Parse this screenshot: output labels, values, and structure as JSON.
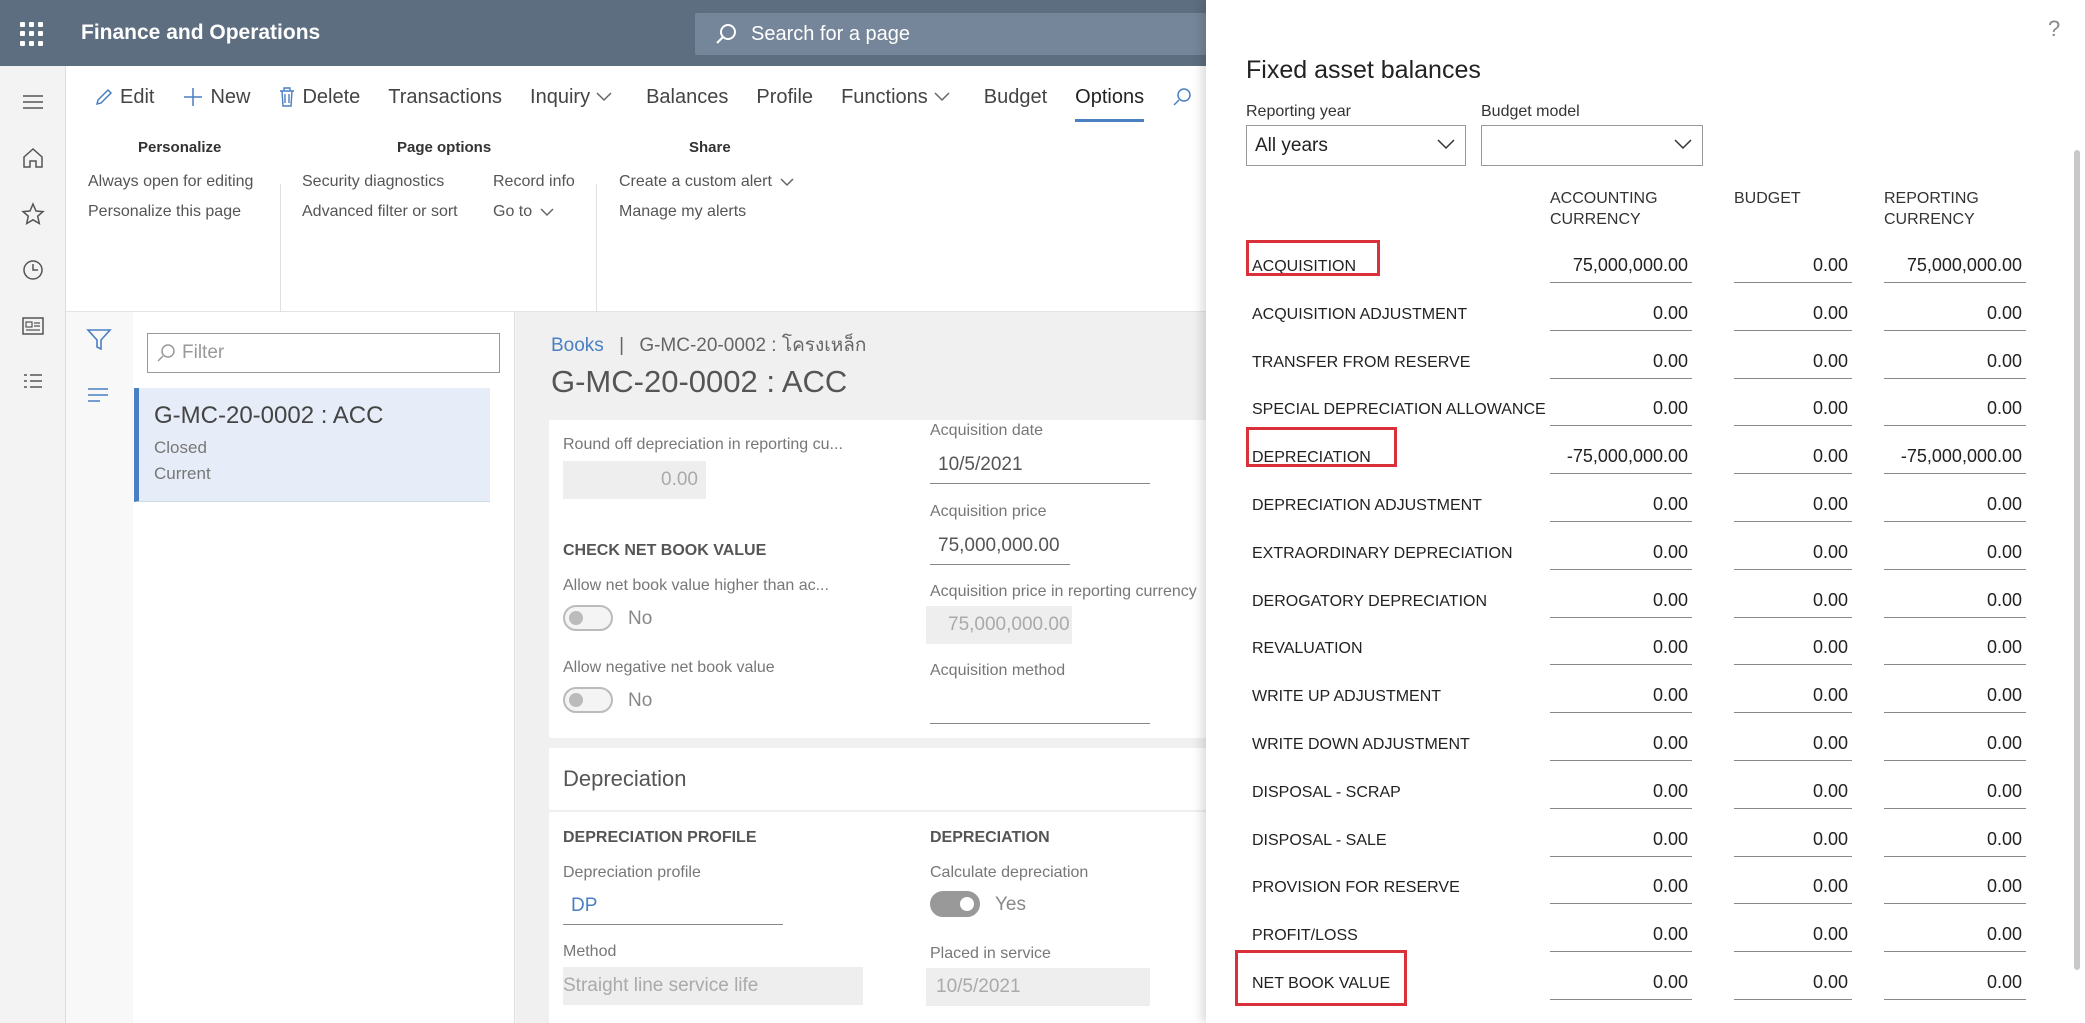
{
  "app": {
    "title": "Finance and Operations",
    "search_placeholder": "Search for a page"
  },
  "actions": [
    {
      "label": "Edit"
    },
    {
      "label": "New"
    },
    {
      "label": "Delete"
    },
    {
      "label": "Transactions"
    },
    {
      "label": "Inquiry"
    },
    {
      "label": "Balances"
    },
    {
      "label": "Profile"
    },
    {
      "label": "Functions"
    },
    {
      "label": "Budget"
    },
    {
      "label": "Options"
    }
  ],
  "options": {
    "personalize": {
      "title": "Personalize",
      "items": [
        "Always open for editing",
        "Personalize this page"
      ]
    },
    "page_options": {
      "title": "Page options",
      "items": [
        "Security diagnostics",
        "Advanced filter or sort",
        "Record info",
        "Go to"
      ]
    },
    "share": {
      "title": "Share",
      "items": [
        "Create a custom alert",
        "Manage my alerts"
      ]
    }
  },
  "list": {
    "filter_placeholder": "Filter",
    "item": {
      "title": "G-MC-20-0002 : ACC",
      "status": "Closed",
      "sub": "Current"
    }
  },
  "detail": {
    "breadcrumb_link": "Books",
    "breadcrumb_sep": "|",
    "breadcrumb_rest": "G-MC-20-0002 : โครงเหล็ก",
    "title": "G-MC-20-0002 : ACC",
    "round_off_label": "Round off depreciation in reporting cu...",
    "round_off_value": "0.00",
    "check_nbv": "CHECK NET BOOK VALUE",
    "allow_higher_label": "Allow net book value higher than ac...",
    "allow_higher_value": "No",
    "allow_negative_label": "Allow negative net book value",
    "allow_negative_value": "No",
    "acq_date_label": "Acquisition date",
    "acq_date": "10/5/2021",
    "acq_price_label": "Acquisition price",
    "acq_price": "75,000,000.00",
    "acq_price_rep_label": "Acquisition price in reporting currency",
    "acq_price_rep": "75,000,000.00",
    "acq_method_label": "Acquisition method",
    "depreciation_header": "Depreciation",
    "dep_profile_section": "DEPRECIATION PROFILE",
    "dep_profile_label": "Depreciation profile",
    "dep_profile": "DP",
    "method_label": "Method",
    "method": "Straight line service life",
    "dep_section": "DEPRECIATION",
    "calc_dep_label": "Calculate depreciation",
    "calc_dep_value": "Yes",
    "placed_label": "Placed in service",
    "placed": "10/5/2021"
  },
  "panel": {
    "title": "Fixed asset balances",
    "help": "?",
    "reporting_year_label": "Reporting year",
    "reporting_year": "All years",
    "budget_model_label": "Budget model",
    "budget_model": "",
    "col_accounting_1": "ACCOUNTING",
    "col_accounting_2": "CURRENCY",
    "col_budget": "BUDGET",
    "col_reporting_1": "REPORTING",
    "col_reporting_2": "CURRENCY",
    "rows": [
      {
        "label": "ACQUISITION",
        "acc": "75,000,000.00",
        "budget": "0.00",
        "rep": "75,000,000.00"
      },
      {
        "label": "ACQUISITION ADJUSTMENT",
        "acc": "0.00",
        "budget": "0.00",
        "rep": "0.00"
      },
      {
        "label": "TRANSFER FROM RESERVE",
        "acc": "0.00",
        "budget": "0.00",
        "rep": "0.00"
      },
      {
        "label": "SPECIAL DEPRECIATION ALLOWANCE",
        "acc": "0.00",
        "budget": "0.00",
        "rep": "0.00"
      },
      {
        "label": "DEPRECIATION",
        "acc": "-75,000,000.00",
        "budget": "0.00",
        "rep": "-75,000,000.00"
      },
      {
        "label": "DEPRECIATION ADJUSTMENT",
        "acc": "0.00",
        "budget": "0.00",
        "rep": "0.00"
      },
      {
        "label": "EXTRAORDINARY DEPRECIATION",
        "acc": "0.00",
        "budget": "0.00",
        "rep": "0.00"
      },
      {
        "label": "DEROGATORY DEPRECIATION",
        "acc": "0.00",
        "budget": "0.00",
        "rep": "0.00"
      },
      {
        "label": "REVALUATION",
        "acc": "0.00",
        "budget": "0.00",
        "rep": "0.00"
      },
      {
        "label": "WRITE UP ADJUSTMENT",
        "acc": "0.00",
        "budget": "0.00",
        "rep": "0.00"
      },
      {
        "label": "WRITE DOWN ADJUSTMENT",
        "acc": "0.00",
        "budget": "0.00",
        "rep": "0.00"
      },
      {
        "label": "DISPOSAL - SCRAP",
        "acc": "0.00",
        "budget": "0.00",
        "rep": "0.00"
      },
      {
        "label": "DISPOSAL - SALE",
        "acc": "0.00",
        "budget": "0.00",
        "rep": "0.00"
      },
      {
        "label": "PROVISION FOR RESERVE",
        "acc": "0.00",
        "budget": "0.00",
        "rep": "0.00"
      },
      {
        "label": "PROFIT/LOSS",
        "acc": "0.00",
        "budget": "0.00",
        "rep": "0.00"
      },
      {
        "label": "NET BOOK VALUE",
        "acc": "0.00",
        "budget": "0.00",
        "rep": "0.00"
      }
    ]
  },
  "colors": {
    "topbar": "#5d6e80",
    "accent": "#4a7fc1",
    "highlight": "#d9303a"
  }
}
